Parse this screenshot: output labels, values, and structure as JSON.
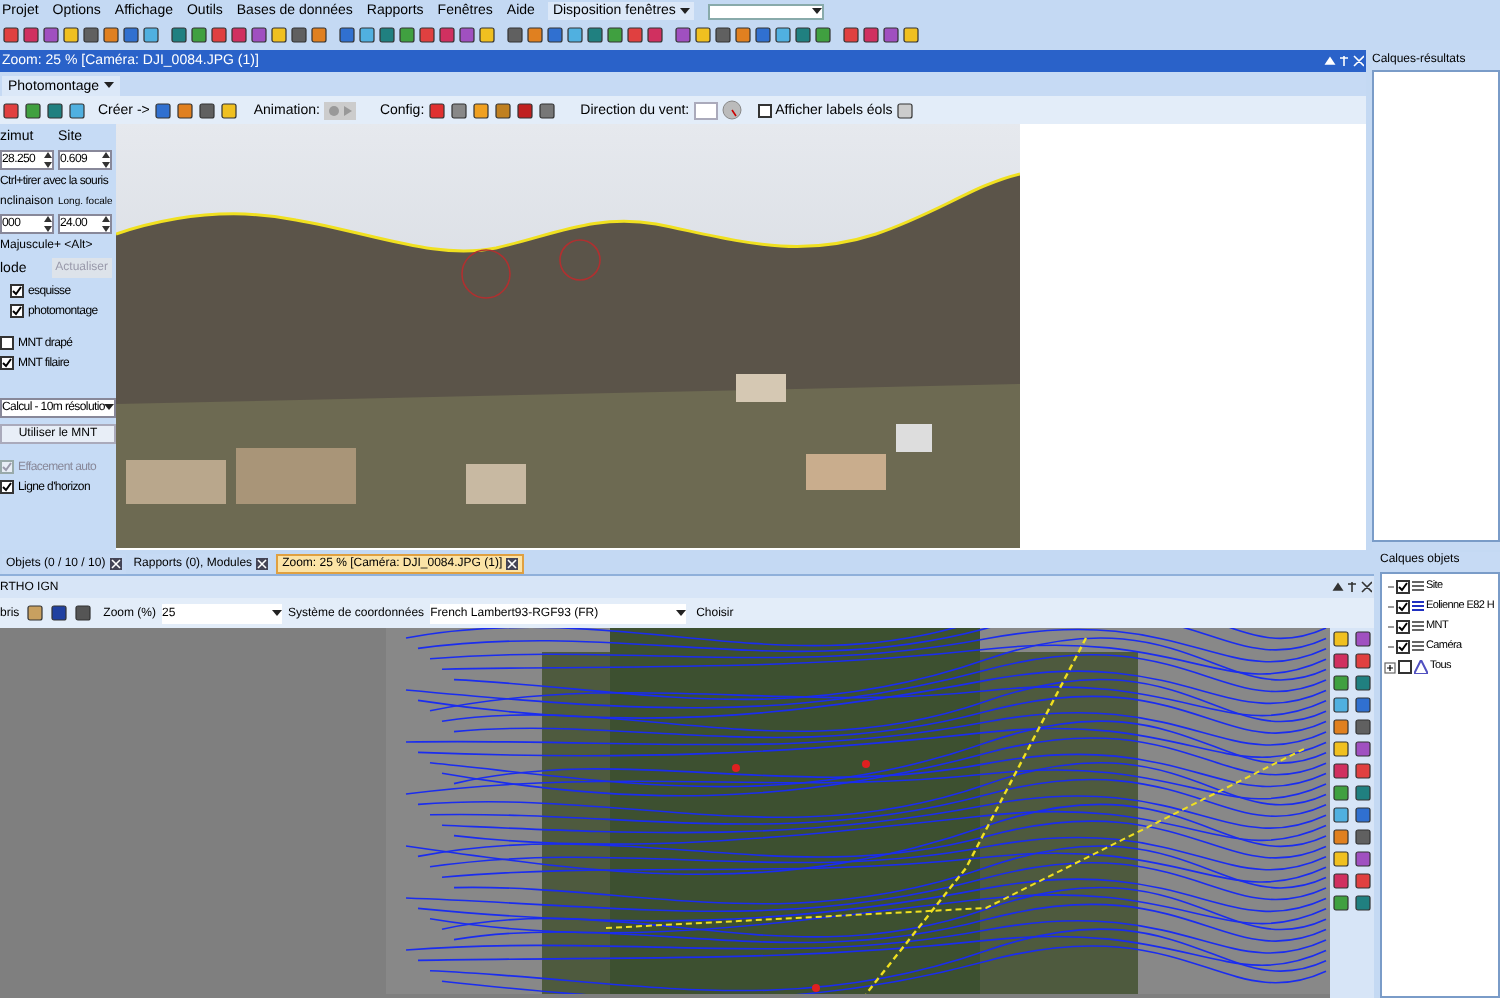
{
  "menu_bar": {
    "items": [
      "Projet",
      "Options",
      "Affichage",
      "Outils",
      "Bases de données",
      "Rapports",
      "Fenêtres",
      "Aide"
    ],
    "layout_menu": "Disposition fenêtres"
  },
  "document_window": {
    "title": "Zoom: 25 % [Caméra: DJI_0084.JPG (1)]",
    "tab": "Photomontage",
    "toolbar": {
      "create_label": "Créer ->",
      "animation_label": "Animation:",
      "config_label": "Config:",
      "wind_label": "Direction du vent:",
      "labels_checkbox": {
        "label": "Afficher labels éols",
        "checked": false
      }
    }
  },
  "camera_panel": {
    "azimuth_label": "zimut",
    "site_label": "Site",
    "azimuth_value": "28.250",
    "site_value": "0.609",
    "drag_hint": "Ctrl+tirer avec la souris",
    "inclination_label": "nclinaison",
    "focal_label": "Long. focale",
    "inclination_value": "000",
    "focal_value": "24.00",
    "shortcut_hint": "Majuscule+ <Alt>",
    "mode_label": "lode",
    "refresh_button": {
      "label": "Actualiser",
      "disabled": true
    },
    "mode_options": [
      {
        "label": "esquisse",
        "checked": true
      },
      {
        "label": "photomontage",
        "checked": true
      }
    ],
    "mnt_options": [
      {
        "label": "MNT drapé",
        "checked": false
      },
      {
        "label": "MNT filaire",
        "checked": true
      }
    ],
    "calc_select": "Calcul - 10m résolutio",
    "use_mnt_button": "Utiliser le MNT",
    "bottom_options": [
      {
        "label": "Effacement auto",
        "checked": true,
        "disabled": true
      },
      {
        "label": "Ligne d'horizon",
        "checked": true,
        "disabled": false
      }
    ]
  },
  "results_panel": {
    "title": "Calques-résultats"
  },
  "doc_tabs": [
    {
      "label": "Objets (0 / 10 / 10)",
      "selected": false
    },
    {
      "label": "Rapports (0), Modules",
      "selected": false
    },
    {
      "label": "Zoom: 25 % [Caméra: DJI_0084.JPG (1)]",
      "selected": true
    }
  ],
  "map_window": {
    "title": "RTHO IGN",
    "toolbar_label": "bris",
    "zoom_label": "Zoom (%)",
    "zoom_value": "25",
    "crs_label": "Système de coordonnées",
    "crs_value": "French Lambert93-RGF93 (FR)",
    "choose_button": "Choisir"
  },
  "objects_panel": {
    "title": "Calques objets",
    "layers": [
      {
        "kind": "layer",
        "label": "Site",
        "checked": true
      },
      {
        "kind": "layer",
        "label": "Eolienne E82 H",
        "checked": true
      },
      {
        "kind": "layer",
        "label": "MNT",
        "checked": true
      },
      {
        "kind": "layer",
        "label": "Caméra",
        "checked": true
      },
      {
        "kind": "group",
        "label": "Tous",
        "checked": false,
        "expanded": false
      }
    ]
  }
}
